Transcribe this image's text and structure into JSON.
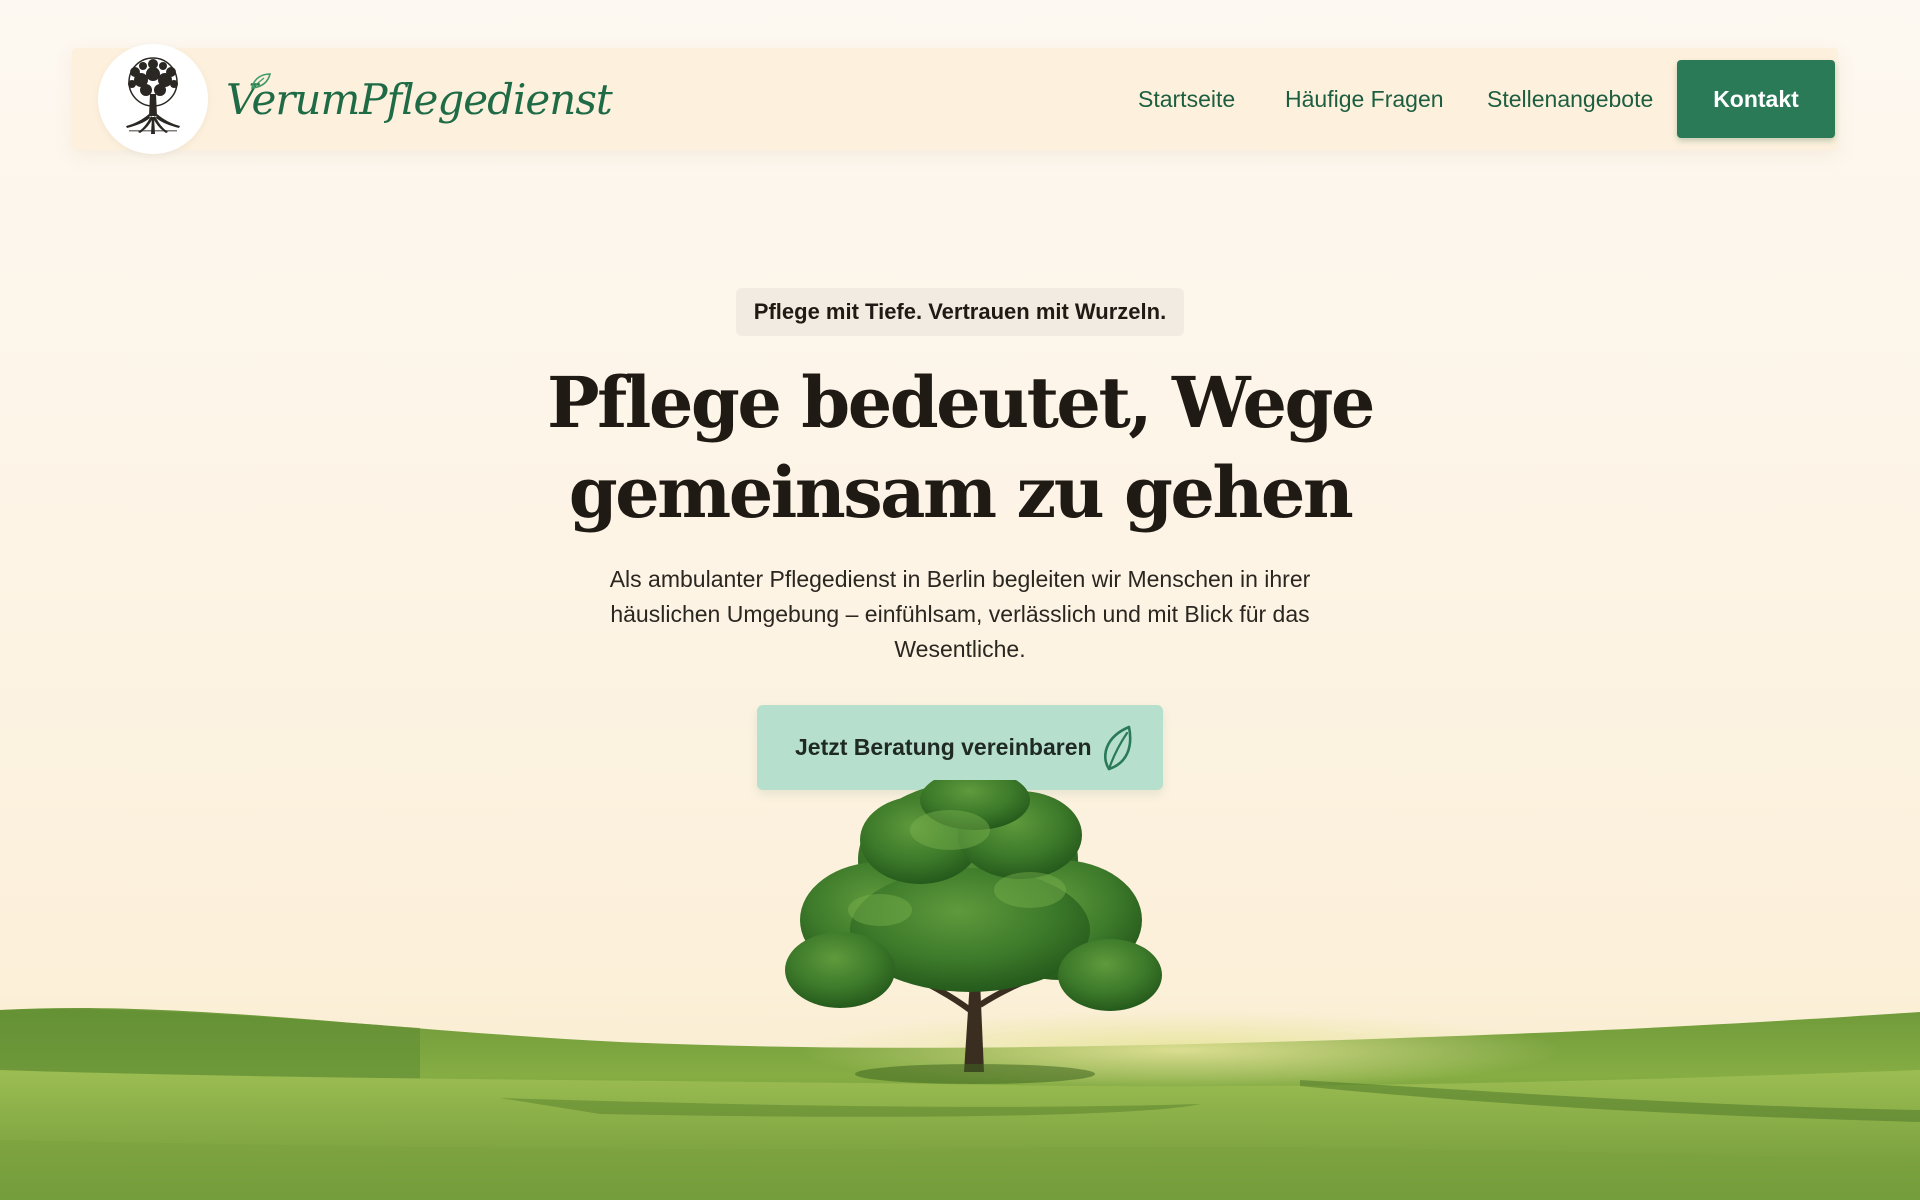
{
  "header": {
    "brand_name": "VerumPflegedienst",
    "logo_icon": "tree-of-life-icon",
    "nav_items": [
      {
        "label": "Startseite"
      },
      {
        "label": "Häufige Fragen"
      },
      {
        "label": "Stellenangebote"
      }
    ],
    "contact_button": "Kontakt"
  },
  "hero": {
    "badge": "Pflege mit Tiefe. Vertrauen mit Wurzeln.",
    "headline_line1": "Pflege bedeutet, Wege",
    "headline_line2": "gemeinsam zu gehen",
    "subtext": "Als ambulanter Pflegedienst in Berlin begleiten wir Menschen in ihrer häuslichen Umgebung – einfühlsam, verlässlich und mit Blick für das Wesentliche.",
    "cta_label": "Jetzt Beratung vereinbaren",
    "cta_icon": "leaf-icon"
  },
  "colors": {
    "brand_green": "#1e6b46",
    "button_green": "#2a7a58",
    "cta_mint": "#b6dfcd",
    "background_cream": "#fdf4e6",
    "header_cream": "#fdf1dd",
    "text_dark": "#1f1a14"
  }
}
